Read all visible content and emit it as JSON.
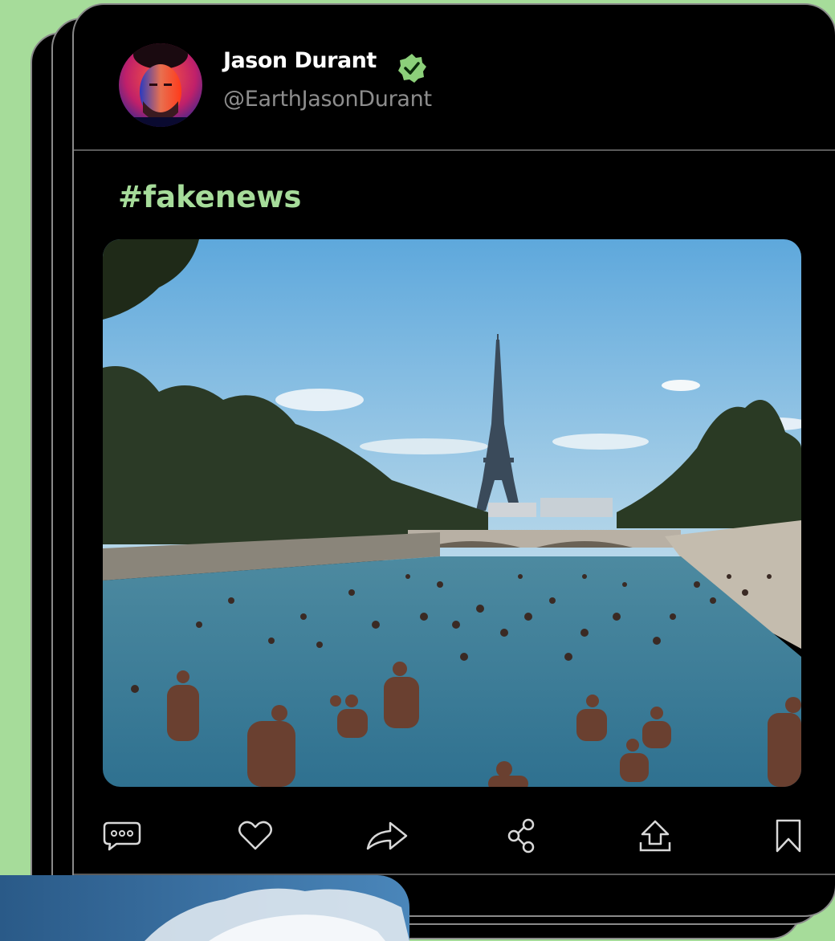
{
  "post": {
    "author_name": "Jason Durant",
    "author_handle": "@EarthJasonDurant",
    "verified": true,
    "text": "#fakenews",
    "image_description": "Crowd swimming in the Seine with the Eiffel Tower in the background"
  },
  "actions": [
    {
      "name": "comment",
      "icon": "comment-bubble-icon"
    },
    {
      "name": "like",
      "icon": "heart-icon"
    },
    {
      "name": "repost",
      "icon": "forward-arrow-icon"
    },
    {
      "name": "share",
      "icon": "share-nodes-icon"
    },
    {
      "name": "upload",
      "icon": "upload-icon"
    },
    {
      "name": "bookmark",
      "icon": "bookmark-icon"
    }
  ],
  "colors": {
    "background": "#a6dc9a",
    "card": "#000000",
    "accent": "#a6dc9a",
    "muted_text": "#8d8d8d"
  }
}
